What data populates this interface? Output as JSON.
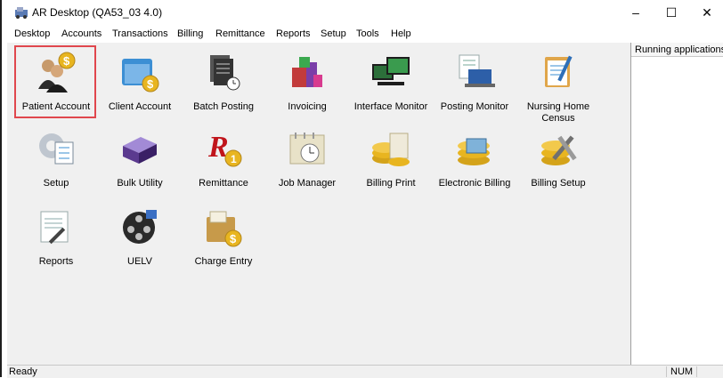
{
  "window": {
    "title": "AR Desktop (QA53_03 4.0)",
    "minimize": "–",
    "maximize": "☐",
    "close": "✕"
  },
  "menu": [
    "Desktop",
    "Accounts",
    "Transactions",
    "Billing",
    "Remittance",
    "Reports",
    "Setup",
    "Tools",
    "Help"
  ],
  "tiles": {
    "patient_account": "Patient Account",
    "client_account": "Client Account",
    "batch_posting": "Batch Posting",
    "invoicing": "Invoicing",
    "interface_monitor": "Interface Monitor",
    "posting_monitor": "Posting Monitor",
    "nursing_home_census": "Nursing Home Census",
    "setup": "Setup",
    "bulk_utility": "Bulk Utility",
    "remittance": "Remittance",
    "job_manager": "Job Manager",
    "billing_print": "Billing Print",
    "electronic_billing": "Electronic Billing",
    "billing_setup": "Billing Setup",
    "reports": "Reports",
    "uelv": "UELV",
    "charge_entry": "Charge Entry"
  },
  "side_panel": {
    "header": "Running applications"
  },
  "statusbar": {
    "left": "Ready",
    "num": "NUM"
  },
  "colors": {
    "selection": "#e0474d",
    "client_bg": "#f0f0f0",
    "coin": "#e8b520"
  },
  "icons": {
    "patient_account": "people-dollar-icon",
    "client_account": "folder-dollar-icon",
    "batch_posting": "documents-clock-icon",
    "invoicing": "colored-blocks-icon",
    "interface_monitor": "monitors-icon",
    "posting_monitor": "laptop-document-icon",
    "nursing_home_census": "clipboard-icon",
    "setup": "gear-document-icon",
    "bulk_utility": "purple-box-icon",
    "remittance": "r-coin-icon",
    "job_manager": "calendar-clock-icon",
    "billing_print": "coins-paper-icon",
    "electronic_billing": "coins-screen-icon",
    "billing_setup": "coins-tools-icon",
    "reports": "document-pen-icon",
    "uelv": "film-reel-icon",
    "charge_entry": "folder-dollar-icon"
  }
}
